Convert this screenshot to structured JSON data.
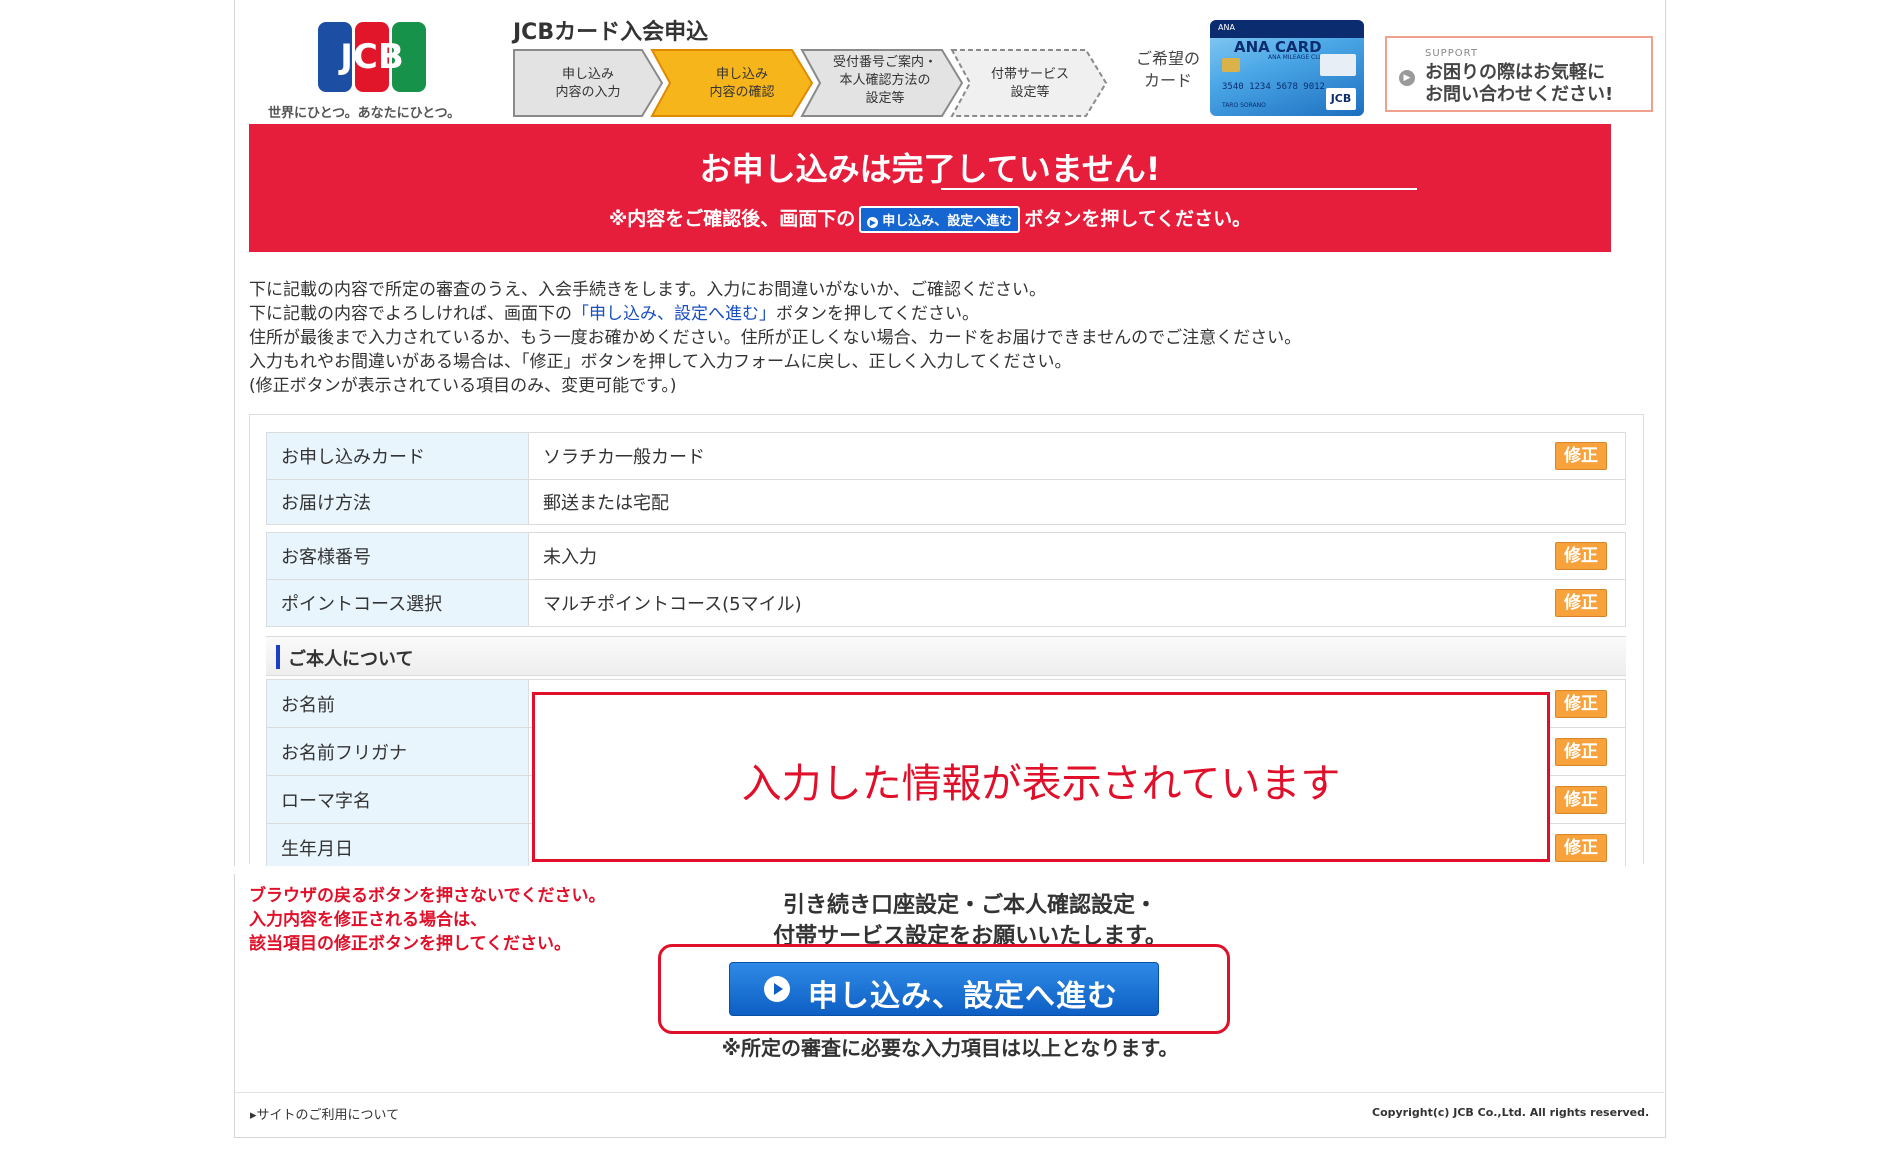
{
  "header": {
    "logo_text": "JCB",
    "logo_tagline": "世界にひとつ。あなたにひとつ。",
    "title": "JCBカード入会申込",
    "steps": [
      {
        "line1": "申し込み",
        "line2": "内容の入力",
        "line3": ""
      },
      {
        "line1": "申し込み",
        "line2": "内容の確認",
        "line3": ""
      },
      {
        "line1": "受付番号ご案内・",
        "line2": "本人確認方法の",
        "line3": "設定等"
      },
      {
        "line1": "付帯サービス",
        "line2": "設定等",
        "line3": ""
      }
    ],
    "wish_label_line1": "ご希望の",
    "wish_label_line2": "カード",
    "card": {
      "title": "ANA CARD",
      "subtitle": "ANA MILEAGE CLUB",
      "number": "3540 1234 5678 9012",
      "name": "TARO SORANO",
      "brand": "JCB"
    },
    "support": {
      "small": "SUPPORT",
      "line1": "お困りの際はお気軽に",
      "line2": "お問い合わせください!"
    }
  },
  "alert": {
    "title": "お申し込みは完了していません!",
    "note_before": "※内容をご確認後、画面下の",
    "note_button": "申し込み、設定へ進む",
    "note_after": "ボタンを押してください。"
  },
  "intro": {
    "line1": "下に記載の内容で所定の審査のうえ、入会手続きをします。入力にお間違いがないか、ご確認ください。",
    "line2_before": "下に記載の内容でよろしければ、画面下の",
    "line2_link": "「申し込み、設定へ進む」",
    "line2_after": "ボタンを押してください。",
    "line3": "住所が最後まで入力されているか、もう一度お確かめください。住所が正しくない場合、カードをお届けできませんのでご注意ください。",
    "line4": "入力もれやお間違いがある場合は、「修正」ボタンを押して入力フォームに戻し、正しく入力してください。",
    "line5": "(修正ボタンが表示されている項目のみ、変更可能です。)"
  },
  "table": {
    "fix_label": "修正",
    "rows": [
      {
        "label": "お申し込みカード",
        "value": "ソラチカ一般カード"
      },
      {
        "label": "お届け方法",
        "value": "郵送または宅配"
      },
      {
        "label": "お客様番号",
        "value": "未入力"
      },
      {
        "label": "ポイントコース選択",
        "value": "マルチポイントコース(5マイル)"
      }
    ],
    "section_title": "ご本人について",
    "personal_rows": [
      {
        "label": "お名前"
      },
      {
        "label": "お名前フリガナ"
      },
      {
        "label": "ローマ字名"
      },
      {
        "label": "生年月日"
      }
    ],
    "overlay_text": "入力した情報が表示されています"
  },
  "bottom": {
    "warn_line1": "ブラウザの戻るボタンを押さないでください。",
    "warn_line2": "入力内容を修正される場合は、",
    "warn_line3": "該当項目の修正ボタンを押してください。",
    "proceed_line1": "引き続き口座設定・ご本人確認設定・",
    "proceed_line2": "付帯サービス設定をお願いいたします。",
    "proceed_button": "申し込み、設定へ進む",
    "final_note": "※所定の審査に必要な入力項目は以上となります。"
  },
  "footer": {
    "link": "サイトのご利用について",
    "copyright": "Copyright(c) JCB Co.,Ltd. All rights reserved."
  },
  "colors": {
    "alert_red": "#e61e3c",
    "step_active": "#f7b51c",
    "button_blue": "#1566d0",
    "fix_orange": "#f7a23a",
    "label_bg": "#e8f5fd"
  }
}
